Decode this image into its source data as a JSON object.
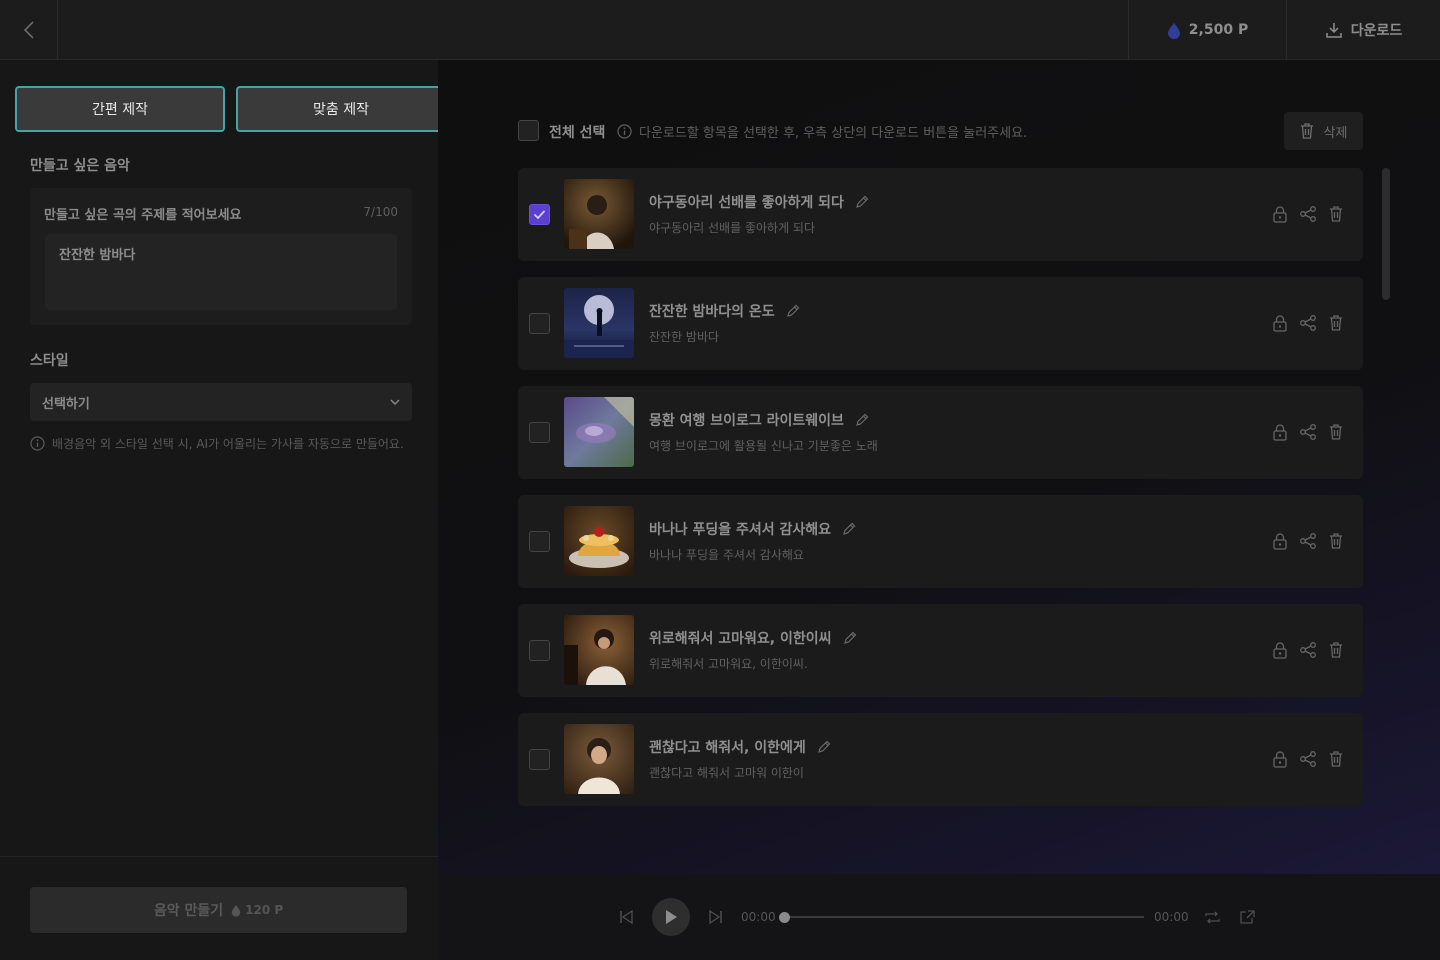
{
  "header": {
    "points": "2,500 P",
    "download_label": "다운로드"
  },
  "left": {
    "tabs": [
      {
        "label": "간편 제작"
      },
      {
        "label": "맞춤 제작"
      }
    ],
    "music_section_title": "만들고 싶은 음악",
    "theme_label": "만들고 싶은 곡의 주제를 적어보세요",
    "theme_count": "7/100",
    "theme_value": "잔잔한 밤바다",
    "style_section_title": "스타일",
    "style_select_value": "선택하기",
    "hint": "배경음악 외 스타일 선택 시, AI가 어울리는 가사를 자동으로 만들어요.",
    "make_button_label": "음악 만들기",
    "make_button_cost": "120 P"
  },
  "toolbar": {
    "select_all_label": "전체 선택",
    "hint": "다운로드할 항목을 선택한 후, 우측 상단의 다운로드 버튼을 눌러주세요.",
    "delete_label": "삭제"
  },
  "songs": [
    {
      "title": "야구동아리 선배를 좋아하게 되다",
      "subtitle": "야구동아리 선배를 좋아하게 되다",
      "checked": true
    },
    {
      "title": "잔잔한 밤바다의 온도",
      "subtitle": "잔잔한 밤바다",
      "checked": false
    },
    {
      "title": "몽환 여행 브이로그 라이트웨이브",
      "subtitle": "여행 브이로그에 활용될 신나고 기분좋은 노래",
      "checked": false
    },
    {
      "title": "바나나 푸딩을 주셔서 감사해요",
      "subtitle": "바나나 푸딩을 주셔서 감사해요",
      "checked": false
    },
    {
      "title": "위로해줘서 고마워요, 이한이씨",
      "subtitle": "위로해줘서 고마워요, 이한이씨.",
      "checked": false
    },
    {
      "title": "괜찮다고 해줘서, 이한에게",
      "subtitle": "괜찮다고 해줘서 고마워 이한이",
      "checked": false
    }
  ],
  "player": {
    "current_time": "00:00",
    "total_time": "00:00",
    "progress": 0
  },
  "colors": {
    "accent_border": "#47a3a8",
    "checkbox_checked": "#5b3fd0"
  }
}
